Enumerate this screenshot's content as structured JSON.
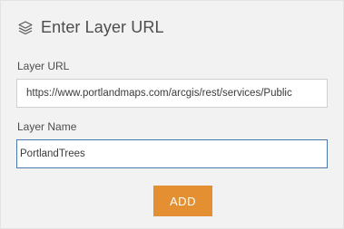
{
  "header": {
    "icon": "layers-icon",
    "title": "Enter Layer URL"
  },
  "form": {
    "url_label": "Layer URL",
    "url_value": "https://www.portlandmaps.com/arcgis/rest/services/Publiс",
    "name_label": "Layer Name",
    "name_value": "PortlandTrees"
  },
  "actions": {
    "add_label": "ADD"
  },
  "colors": {
    "accent": "#e58f33",
    "focus_border": "#4a7ba8",
    "panel_bg": "#f2f2f2"
  }
}
